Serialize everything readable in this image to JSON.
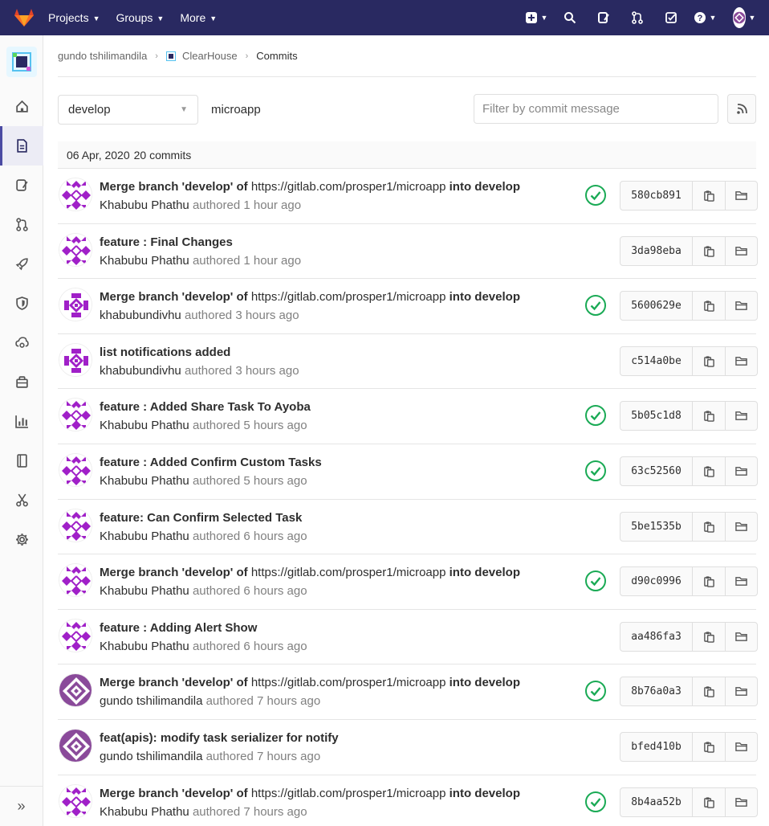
{
  "nav": {
    "items": [
      {
        "label": "Projects",
        "name": "nav-projects"
      },
      {
        "label": "Groups",
        "name": "nav-groups"
      },
      {
        "label": "More",
        "name": "nav-more"
      }
    ]
  },
  "breadcrumb": {
    "owner": "gundo tshilimandila",
    "project": "ClearHouse",
    "current": "Commits"
  },
  "toolbar": {
    "branch": "develop",
    "project_path": "microapp",
    "filter_placeholder": "Filter by commit message"
  },
  "day": {
    "date": "06 Apr, 2020",
    "count": "20 commits"
  },
  "colors": {
    "nav_bg": "#292961",
    "success": "#1aaa55",
    "avatar_purple": "#a020c8",
    "avatar_gundo": "#8a4a9a"
  },
  "commits": [
    {
      "title": "Merge branch 'develop' of",
      "link": "https://gitlab.com/prosper1/microapp",
      "suffix": "into develop",
      "author": "Khabubu Phathu",
      "authored": "authored",
      "time": "1 hour ago",
      "sha": "580cb891",
      "status": true,
      "avatar": "kp"
    },
    {
      "title": "feature : Final Changes",
      "link": "",
      "suffix": "",
      "author": "Khabubu Phathu",
      "authored": "authored",
      "time": "1 hour ago",
      "sha": "3da98eba",
      "status": false,
      "avatar": "kp"
    },
    {
      "title": "Merge branch 'develop' of",
      "link": "https://gitlab.com/prosper1/microapp",
      "suffix": "into develop",
      "author": "khabubundivhu",
      "authored": "authored",
      "time": "3 hours ago",
      "sha": "5600629e",
      "status": true,
      "avatar": "kn"
    },
    {
      "title": "list notifications added",
      "link": "",
      "suffix": "",
      "author": "khabubundivhu",
      "authored": "authored",
      "time": "3 hours ago",
      "sha": "c514a0be",
      "status": false,
      "avatar": "kn"
    },
    {
      "title": "feature : Added Share Task To Ayoba",
      "link": "",
      "suffix": "",
      "author": "Khabubu Phathu",
      "authored": "authored",
      "time": "5 hours ago",
      "sha": "5b05c1d8",
      "status": true,
      "avatar": "kp"
    },
    {
      "title": "feature : Added Confirm Custom Tasks",
      "link": "",
      "suffix": "",
      "author": "Khabubu Phathu",
      "authored": "authored",
      "time": "5 hours ago",
      "sha": "63c52560",
      "status": true,
      "avatar": "kp"
    },
    {
      "title": "feature: Can Confirm Selected Task",
      "link": "",
      "suffix": "",
      "author": "Khabubu Phathu",
      "authored": "authored",
      "time": "6 hours ago",
      "sha": "5be1535b",
      "status": false,
      "avatar": "kp"
    },
    {
      "title": "Merge branch 'develop' of",
      "link": "https://gitlab.com/prosper1/microapp",
      "suffix": "into develop",
      "author": "Khabubu Phathu",
      "authored": "authored",
      "time": "6 hours ago",
      "sha": "d90c0996",
      "status": true,
      "avatar": "kp"
    },
    {
      "title": "feature : Adding Alert Show",
      "link": "",
      "suffix": "",
      "author": "Khabubu Phathu",
      "authored": "authored",
      "time": "6 hours ago",
      "sha": "aa486fa3",
      "status": false,
      "avatar": "kp"
    },
    {
      "title": "Merge branch 'develop' of",
      "link": "https://gitlab.com/prosper1/microapp",
      "suffix": "into develop",
      "author": "gundo tshilimandila",
      "authored": "authored",
      "time": "7 hours ago",
      "sha": "8b76a0a3",
      "status": true,
      "avatar": "gt"
    },
    {
      "title": "feat(apis): modify task serializer for notify",
      "link": "",
      "suffix": "",
      "author": "gundo tshilimandila",
      "authored": "authored",
      "time": "7 hours ago",
      "sha": "bfed410b",
      "status": false,
      "avatar": "gt"
    },
    {
      "title": "Merge branch 'develop' of",
      "link": "https://gitlab.com/prosper1/microapp",
      "suffix": "into develop",
      "author": "Khabubu Phathu",
      "authored": "authored",
      "time": "7 hours ago",
      "sha": "8b4aa52b",
      "status": true,
      "avatar": "kp"
    }
  ]
}
